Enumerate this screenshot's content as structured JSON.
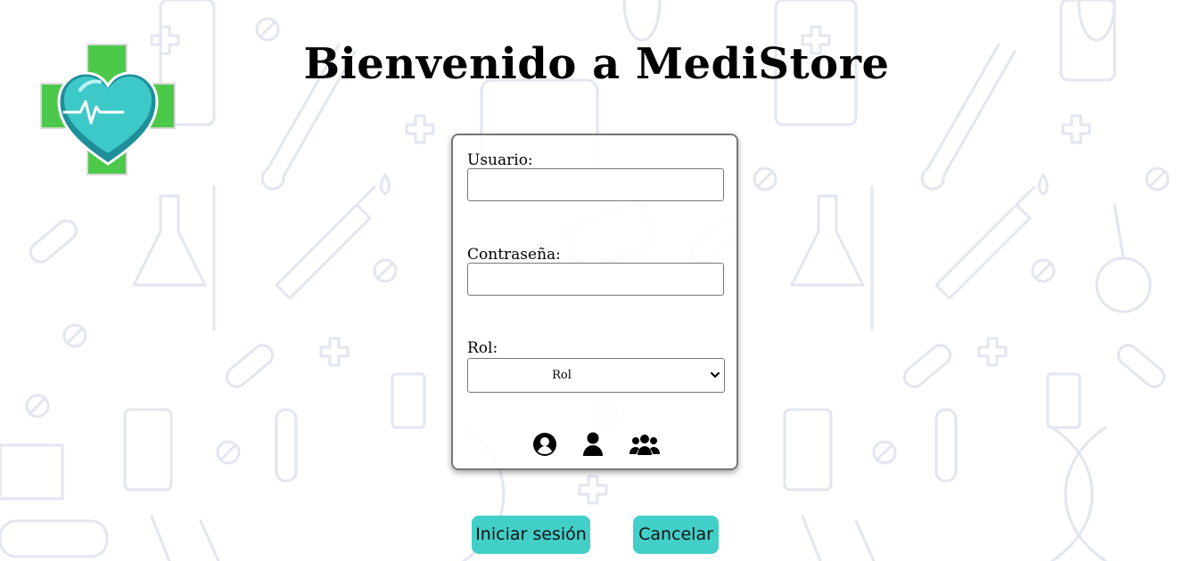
{
  "page": {
    "title": "Bienvenido a MediStore"
  },
  "form": {
    "username_label": "Usuario:",
    "username_value": "",
    "password_label": "Contraseña:",
    "password_value": "",
    "role_label": "Rol:",
    "role_selected": "Rol"
  },
  "role_icons": [
    "user-circle-icon",
    "user-icon",
    "users-group-icon"
  ],
  "actions": {
    "login_label": "Iniciar sesión",
    "cancel_label": "Cancelar"
  },
  "colors": {
    "accent": "#41cfc8",
    "logo_cross": "#4cc94a",
    "logo_heart": "#3ec9c9"
  }
}
